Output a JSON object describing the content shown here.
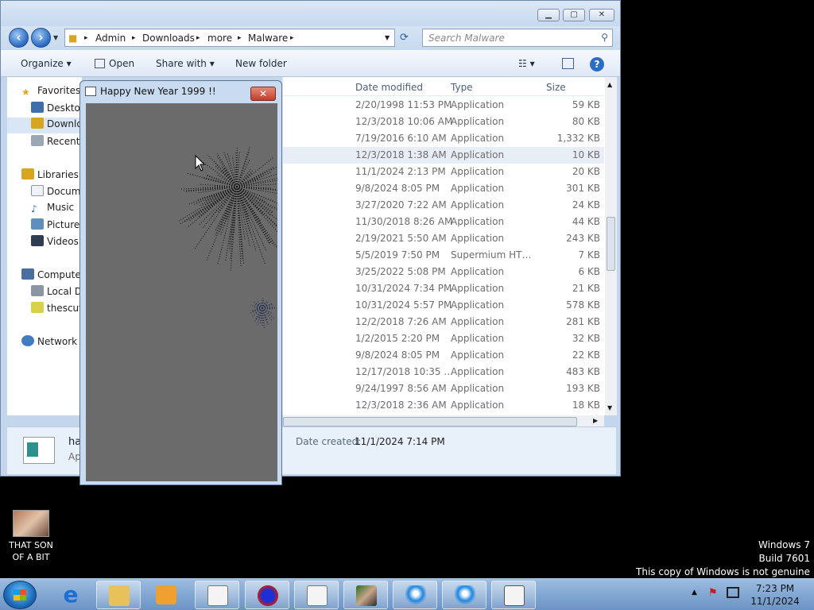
{
  "explorer": {
    "breadcrumb": [
      "Admin",
      "Downloads",
      "more",
      "Malware"
    ],
    "search_placeholder": "Search Malware",
    "toolbar": {
      "organize": "Organize",
      "open": "Open",
      "share_with": "Share with",
      "new_folder": "New folder"
    },
    "nav": {
      "favorites": "Favorites",
      "desktop": "Desktop",
      "downloads": "Downloads",
      "recent": "Recent Places",
      "libraries": "Libraries",
      "documents": "Documents",
      "music": "Music",
      "pictures": "Pictures",
      "videos": "Videos",
      "computer": "Computer",
      "local_disk": "Local Disk",
      "thescuff": "thescuff",
      "network": "Network"
    },
    "columns": {
      "date": "Date modified",
      "type": "Type",
      "size": "Size"
    },
    "rows": [
      {
        "date": "2/20/1998 11:53 PM",
        "type": "Application",
        "size": "59 KB"
      },
      {
        "date": "12/3/2018 10:06 AM",
        "type": "Application",
        "size": "80 KB"
      },
      {
        "date": "7/19/2016 6:10 AM",
        "type": "Application",
        "size": "1,332 KB"
      },
      {
        "date": "12/3/2018 1:38 AM",
        "type": "Application",
        "size": "10 KB"
      },
      {
        "date": "11/1/2024 2:13 PM",
        "type": "Application",
        "size": "20 KB"
      },
      {
        "date": "9/8/2024 8:05 PM",
        "type": "Application",
        "size": "301 KB"
      },
      {
        "date": "3/27/2020 7:22 AM",
        "type": "Application",
        "size": "24 KB"
      },
      {
        "date": "11/30/2018 8:26 AM",
        "type": "Application",
        "size": "44 KB"
      },
      {
        "date": "2/19/2021 5:50 AM",
        "type": "Application",
        "size": "243 KB"
      },
      {
        "date": "5/5/2019 7:50 PM",
        "type": "Supermium HTM...",
        "size": "7 KB"
      },
      {
        "date": "3/25/2022 5:08 PM",
        "type": "Application",
        "size": "6 KB"
      },
      {
        "date": "10/31/2024 7:34 PM",
        "type": "Application",
        "size": "21 KB"
      },
      {
        "date": "10/31/2024 5:57 PM",
        "type": "Application",
        "size": "578 KB"
      },
      {
        "date": "12/2/2018 7:26 AM",
        "type": "Application",
        "size": "281 KB"
      },
      {
        "date": "1/2/2015 2:20 PM",
        "type": "Application",
        "size": "32 KB"
      },
      {
        "date": "9/8/2024 8:05 PM",
        "type": "Application",
        "size": "22 KB"
      },
      {
        "date": "12/17/2018 10:35 ...",
        "type": "Application",
        "size": "483 KB"
      },
      {
        "date": "9/24/1997 8:56 AM",
        "type": "Application",
        "size": "193 KB"
      },
      {
        "date": "12/3/2018 2:36 AM",
        "type": "Application",
        "size": "18 KB"
      }
    ],
    "details": {
      "name": "ha",
      "kind": "Ap",
      "date_created_label": "Date created:",
      "date_created": "11/1/2024 7:14 PM"
    }
  },
  "popup": {
    "title": "Happy New Year 1999 !!"
  },
  "desktop": {
    "icon_label": "THAT SON OF A BIT"
  },
  "watermark": {
    "line1": "Windows 7",
    "line2": "Build 7601",
    "line3": "This copy of Windows is not genuine"
  },
  "clock": {
    "time": "7:23 PM",
    "date": "11/1/2024"
  },
  "colors": {
    "popup_bg": "#6b6b6b",
    "taskbar": "#7ea3cf"
  }
}
